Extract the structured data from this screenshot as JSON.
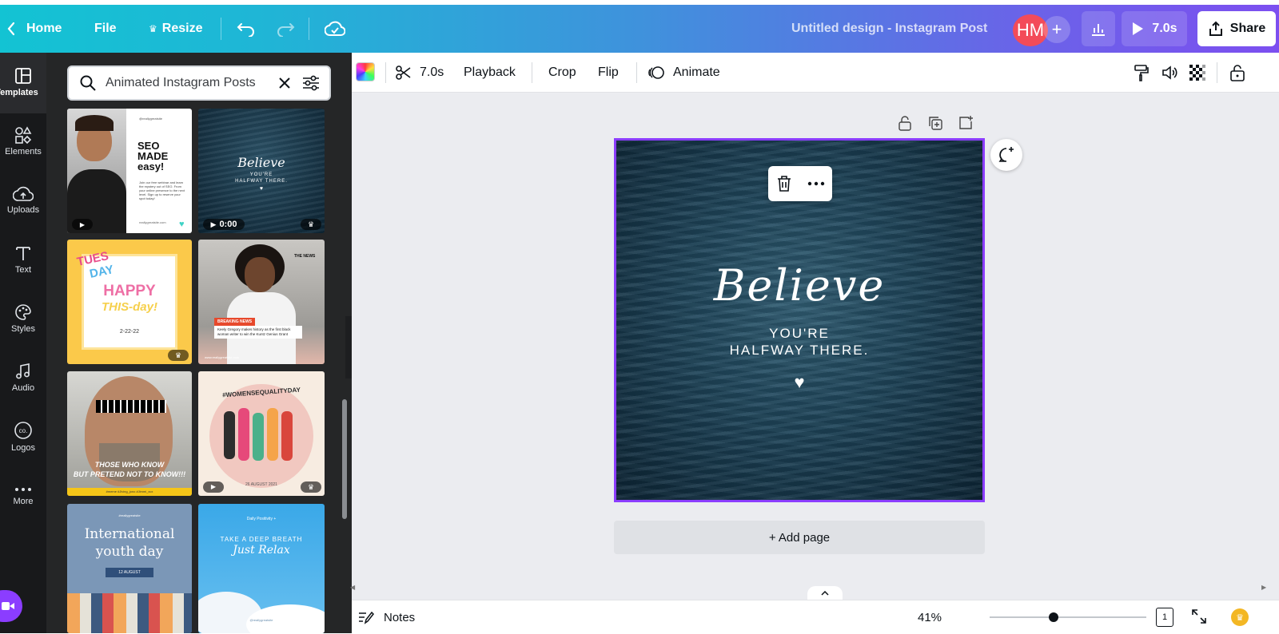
{
  "topbar": {
    "home_label": "Home",
    "file_label": "File",
    "resize_label": "Resize",
    "design_title": "Untitled design - Instagram Post",
    "avatar_initials": "HM",
    "play_label": "7.0s",
    "share_label": "Share"
  },
  "leftnav": {
    "items": [
      {
        "label": "Templates",
        "icon": "templates-icon"
      },
      {
        "label": "Elements",
        "icon": "elements-icon"
      },
      {
        "label": "Uploads",
        "icon": "uploads-icon"
      },
      {
        "label": "Text",
        "icon": "text-icon"
      },
      {
        "label": "Styles",
        "icon": "styles-icon"
      },
      {
        "label": "Audio",
        "icon": "audio-icon"
      },
      {
        "label": "Logos",
        "icon": "logos-icon"
      },
      {
        "label": "More",
        "icon": "more-icon"
      }
    ]
  },
  "panel": {
    "search_value": "Animated Instagram Posts",
    "templates": {
      "t1": {
        "handle": "@reallygreatsite",
        "title": "SEO MADE easy!",
        "body": "Join our free webinar and learn the mystery out of SEO. From your online presence to the next level. Sign up to reserve your spot today!",
        "footer": "reallygreatsite.com"
      },
      "t2": {
        "script": "Believe",
        "line1": "YOU'RE",
        "line2": "HALFWAY THERE.",
        "time": "0:00"
      },
      "t3": {
        "tues": "TUES",
        "day": "DAY",
        "happy": "HAPPY",
        "thisday": "THIS-day!",
        "date": "2-22-22"
      },
      "t4": {
        "badge": "THE NEWS",
        "breaking": "BREAKING NEWS",
        "body": "Keely Gregory makes history as the first black woman writer to win the Kuntz Genius Grant",
        "footer": "www.reallygreatsite.com"
      },
      "t5": {
        "line1": "THOSE WHO KNOW",
        "line2": "BUT PRETEND NOT TO KNOW!!!",
        "footer": "#meme #Jiving_jono #Jimmi_xcx"
      },
      "t6": {
        "tag": "#WOMENSEQUALITYDAY",
        "date": "26 AUGUST 2021"
      },
      "t7": {
        "handle": "#reallygreatsite",
        "title1": "International",
        "title2": "youth day",
        "ribbon": "12 AUGUST"
      },
      "t8": {
        "top": "Daily Positivity +",
        "line1": "TAKE A DEEP BREATH",
        "line2": "Just Relax",
        "handle": "@reallygreatsite"
      }
    }
  },
  "toolbar": {
    "duration_label": "7.0s",
    "playback_label": "Playback",
    "crop_label": "Crop",
    "flip_label": "Flip",
    "animate_label": "Animate"
  },
  "canvas": {
    "script_text": "Believe",
    "line1": "YOU'RE",
    "line2": "HALFWAY THERE.",
    "heart": "♥"
  },
  "add_page_label": "+ Add page",
  "bottombar": {
    "notes_label": "Notes",
    "zoom_label": "41%",
    "zoom_value": 0.41,
    "page_number": "1"
  }
}
